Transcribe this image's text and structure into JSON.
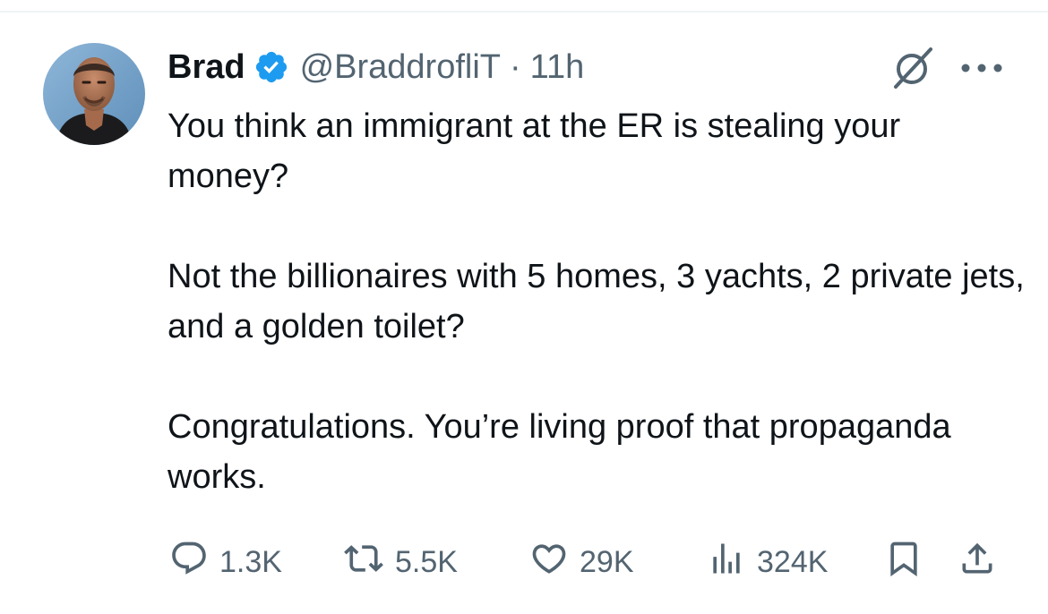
{
  "post": {
    "author_name": "Brad",
    "author_handle": "@BraddrofliT",
    "separator": "·",
    "time_ago": "11h",
    "verified_color": "#1d9bf0",
    "text_paragraphs": [
      "You think an immigrant at the ER is stealing your money?",
      "Not the billionaires with 5 homes, 3 yachts, 2 private jets, and a golden toilet?",
      "Congratulations. You’re living proof that propaganda works."
    ]
  },
  "actions": {
    "reply": {
      "icon": "reply-icon",
      "count": "1.3K"
    },
    "repost": {
      "icon": "repost-icon",
      "count": "5.5K"
    },
    "like": {
      "icon": "heart-icon",
      "count": "29K"
    },
    "views": {
      "icon": "views-icon",
      "count": "324K"
    },
    "bookmark": {
      "icon": "bookmark-icon"
    },
    "share": {
      "icon": "share-icon"
    }
  },
  "header_icons": {
    "grok": "grok-icon",
    "more": "more-icon"
  },
  "colors": {
    "text": "#0f1419",
    "secondary": "#536471",
    "accent": "#1d9bf0"
  }
}
